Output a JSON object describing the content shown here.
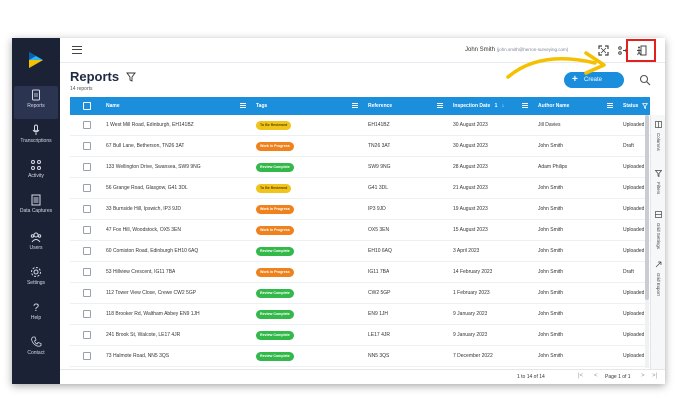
{
  "topbar": {
    "user_name": "John Smith",
    "user_email": "(john.smith@herron-surveying.com)"
  },
  "sidebar": {
    "items": [
      {
        "label": "Reports",
        "icon": "document-icon",
        "active": true
      },
      {
        "label": "Transcriptions",
        "icon": "microphone-icon"
      },
      {
        "label": "Activity",
        "icon": "activity-icon"
      },
      {
        "label": "Data Captures",
        "icon": "data-captures-icon"
      },
      {
        "label": "Users",
        "icon": "users-icon"
      },
      {
        "label": "Settings",
        "icon": "gear-icon"
      },
      {
        "label": "Help",
        "icon": "help-icon"
      },
      {
        "label": "Contact",
        "icon": "phone-icon"
      }
    ]
  },
  "header": {
    "title": "Reports",
    "count": "14 reports",
    "create_label": "Create",
    "create_icon": "+"
  },
  "table": {
    "columns": [
      "Name",
      "Tags",
      "Reference",
      "Inspection Date",
      "Author Name",
      "Status"
    ],
    "sort_indicator": "1",
    "rows": [
      {
        "name": "1 West Mill Road, Edinburgh, EH141BZ",
        "tag": "To Be Reviewed",
        "tag_color": "yellow",
        "ref": "EH141BZ",
        "date": "30 August 2023",
        "author": "Jill Davies",
        "status": "Uploaded"
      },
      {
        "name": "67 Bull Lane, Betherson, TN26 3AT",
        "tag": "Work In Progress",
        "tag_color": "orange",
        "ref": "TN26 3AT",
        "date": "30 August 2023",
        "author": "John Smith",
        "status": "Draft"
      },
      {
        "name": "133 Wellington Drive, Swansea, SW9 9NG",
        "tag": "Review Complete",
        "tag_color": "green",
        "ref": "SW9 9NG",
        "date": "28 August 2023",
        "author": "Adam Philips",
        "status": "Uploaded"
      },
      {
        "name": "56 Grange Road, Glasgow, G41 3DL",
        "tag": "To Be Reviewed",
        "tag_color": "yellow",
        "ref": "G41 3DL",
        "date": "21 August 2023",
        "author": "John Smith",
        "status": "Uploaded"
      },
      {
        "name": "33 Burnside Hill, Ipswich, IP3 9JD",
        "tag": "Work In Progress",
        "tag_color": "orange",
        "ref": "IP3 9JD",
        "date": "19 August 2023",
        "author": "John Smith",
        "status": "Uploaded"
      },
      {
        "name": "47 Fox Hill, Woodstock, OX5 3EN",
        "tag": "Work In Progress",
        "tag_color": "orange",
        "ref": "OX5 3EN",
        "date": "15 August 2023",
        "author": "John Smith",
        "status": "Uploaded"
      },
      {
        "name": "60 Comiston Road, Edinburgh EH10 6AQ",
        "tag": "Review Complete",
        "tag_color": "green",
        "ref": "EH10 6AQ",
        "date": "3 April 2023",
        "author": "John Smith",
        "status": "Uploaded"
      },
      {
        "name": "53 Hillview Crescent, IG11 7BA",
        "tag": "Work In Progress",
        "tag_color": "orange",
        "ref": "IG11 7BA",
        "date": "14 February 2023",
        "author": "John Smith",
        "status": "Draft"
      },
      {
        "name": "112 Tower View Close, Crewe CW2 5GP",
        "tag": "Review Complete",
        "tag_color": "green",
        "ref": "CW2 5GP",
        "date": "1 February 2023",
        "author": "John Smith",
        "status": "Uploaded"
      },
      {
        "name": "118 Brooker Rd, Waltham Abbey EN9 1JH",
        "tag": "Review Complete",
        "tag_color": "green",
        "ref": "EN9 1JH",
        "date": "9 January 2023",
        "author": "John Smith",
        "status": "Uploaded"
      },
      {
        "name": "241 Brook St, Walcote, LE17 4JR",
        "tag": "Review Complete",
        "tag_color": "green",
        "ref": "LE17 4JR",
        "date": "9 January 2023",
        "author": "John Smith",
        "status": "Uploaded"
      },
      {
        "name": "73 Halmote Road, NN5 3QS",
        "tag": "Review Complete",
        "tag_color": "green",
        "ref": "NN5 3QS",
        "date": "7 December 2022",
        "author": "John Smith",
        "status": "Uploaded"
      }
    ]
  },
  "side_panel": {
    "items": [
      "Columns",
      "Filters",
      "Grid Settings",
      "Grid Export"
    ]
  },
  "footer": {
    "range": "1 to 14 of 14",
    "page_label": "Page 1 of 1"
  },
  "colors": {
    "accent": "#1b8fdc",
    "sidebar": "#1b2236",
    "highlight_box": "#e0211d",
    "annotation_arrow": "#f5c000"
  }
}
